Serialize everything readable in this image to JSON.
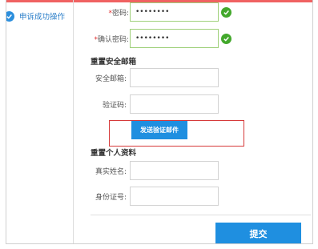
{
  "sidebar": {
    "item_label": "申诉成功操作",
    "item_icon": "check-circle-icon"
  },
  "password": {
    "label": "密码:",
    "required_mark": "*",
    "value": "••••••••"
  },
  "confirm_password": {
    "label": "确认密码:",
    "required_mark": "*",
    "value": "••••••••"
  },
  "reset_email": {
    "title": "重置安全邮箱",
    "email_label": "安全邮箱:",
    "email_value": "",
    "code_label": "验证码:",
    "code_value": "",
    "send_button": "发送验证邮件"
  },
  "reset_profile": {
    "title": "重置个人资料",
    "name_label": "真实姓名:",
    "name_value": "",
    "id_label": "身份证号:",
    "id_value": ""
  },
  "submit_label": "提交",
  "colors": {
    "accent": "#1f8fe0",
    "valid": "#43a82c",
    "error": "#d63a3a"
  }
}
